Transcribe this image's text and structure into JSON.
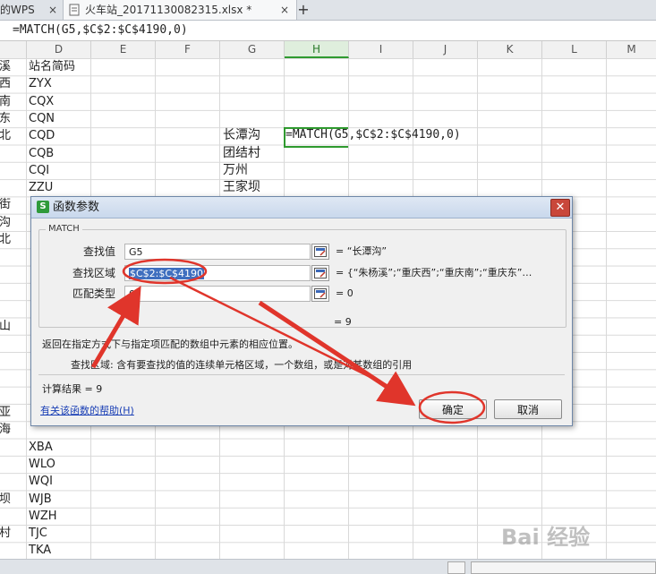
{
  "tabs": [
    {
      "label": "的WPS",
      "close": "×"
    },
    {
      "label": "火车站_20171130082315.xlsx *",
      "close": "×"
    },
    {
      "label": "+"
    }
  ],
  "formula_bar": {
    "text": "=MATCH(G5,$C$2:$C$4190,0)"
  },
  "columns": [
    "D",
    "E",
    "F",
    "G",
    "H",
    "I",
    "J",
    "K",
    "L",
    "M"
  ],
  "col_c_partial": [
    "溪",
    "西",
    "南",
    "东",
    "北",
    "",
    "",
    "",
    "街",
    "沟",
    "北",
    "",
    "",
    "",
    "",
    "山",
    "",
    "",
    "",
    "",
    "亚",
    "海",
    "",
    "",
    "",
    "坝",
    "",
    "村"
  ],
  "col_d": [
    "站名简码",
    "ZYX",
    "CQX",
    "CQN",
    "CQD",
    "CQB",
    "CQI",
    "ZZU",
    "",
    "",
    "",
    "",
    "",
    "",
    "",
    "",
    "",
    "",
    "",
    "",
    "",
    "",
    "XBA",
    "WLO",
    "WQI",
    "WJB",
    "WZH",
    "TJC",
    "TKA"
  ],
  "col_g": [
    "长潭沟",
    "团结村",
    "万州",
    "王家坝"
  ],
  "cell_h5": "=MATCH(G5,$C$2:$C$4190,0)",
  "dialog": {
    "title": "函数参数",
    "group": "MATCH",
    "params": [
      {
        "label": "查找值",
        "value": "G5",
        "result": "= “长潭沟”"
      },
      {
        "label": "查找区域",
        "value": "$C$2:$C$4190",
        "result": "= {“朱杨溪”;“重庆西”;“重庆南”;“重庆东”…"
      },
      {
        "label": "匹配类型",
        "value": "0",
        "result": "= 0"
      }
    ],
    "total": "= 9",
    "desc1": "返回在指定方式下与指定项匹配的数组中元素的相应位置。",
    "desc2": "查找区域:  含有要查找的值的连续单元格区域，一个数组，或是对某数组的引用",
    "calc": "计算结果 = 9",
    "help": "有关该函数的帮助(H)",
    "ok": "确定",
    "cancel": "取消"
  },
  "watermark": "Bai 经验",
  "colors": {
    "accent_green": "#2f9a2f",
    "arrow_red": "#e0352b",
    "dialog_border": "#6f87a8"
  }
}
